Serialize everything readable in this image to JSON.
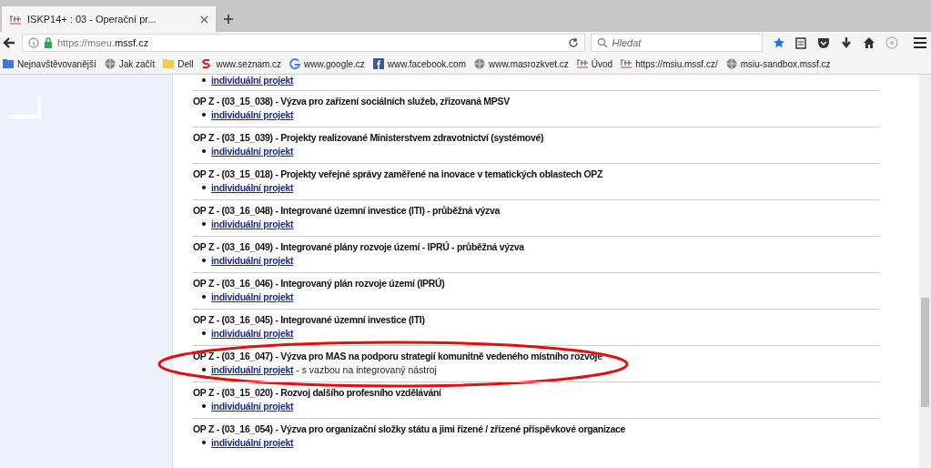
{
  "browser": {
    "tab": {
      "title": "ISKP14+ : 03 - Operační pr...",
      "selected": true
    },
    "url": {
      "prefix": "https://mseu.",
      "domain": "mssf.cz"
    },
    "search": {
      "placeholder": "Hledat"
    },
    "bookmarks": [
      {
        "kind": "folder-blue",
        "label": "Nejnavštěvovanější"
      },
      {
        "kind": "globe",
        "label": "Jak začít"
      },
      {
        "kind": "folder",
        "label": "Dell"
      },
      {
        "kind": "s",
        "label": "www.seznam.cz"
      },
      {
        "kind": "g",
        "label": "www.google.cz"
      },
      {
        "kind": "f",
        "label": "www.facebook.com"
      },
      {
        "kind": "globe",
        "label": "www.masrozkvet.cz"
      },
      {
        "kind": "iskp",
        "label": "Úvod"
      },
      {
        "kind": "iskp",
        "label": "https://msiu.mssf.cz/"
      },
      {
        "kind": "globe",
        "label": "msiu-sandbox.mssf.cz"
      }
    ]
  },
  "calls": [
    {
      "link": "individuální projekt",
      "highlighted": false
    },
    {
      "title": "OP Z - (03_15_038) - Výzva pro zařízení sociálních služeb, zřizovaná MPSV",
      "link": "individuální projekt",
      "highlighted": false
    },
    {
      "title": "OP Z - (03_15_039) - Projekty realizované Ministerstvem zdravotnictví (systémové)",
      "link": "individuální projekt",
      "highlighted": false
    },
    {
      "title": "OP Z - (03_15_018) - Projekty veřejné správy zaměřené na inovace v tematických oblastech OPZ",
      "link": "individuální projekt",
      "highlighted": false
    },
    {
      "title": "OP Z - (03_16_048) - Integrované územní investice (ITI) - průběžná výzva",
      "link": "individuální projekt",
      "highlighted": false
    },
    {
      "title": "OP Z - (03_16_049) - Integrované plány rozvoje území - IPRÚ - průběžná výzva",
      "link": "individuální projekt",
      "highlighted": false
    },
    {
      "title": "OP Z - (03_16_046) - Integrovaný plán rozvoje území (IPRÚ)",
      "link": "individuální projekt",
      "highlighted": false
    },
    {
      "title": "OP Z - (03_16_045) - Integrované územní investice (ITI)",
      "link": "individuální projekt",
      "highlighted": false
    },
    {
      "title": "OP Z - (03_16_047) - Výzva pro MAS na podporu strategií komunitně vedeného místního rozvoje",
      "link": "individuální projekt",
      "note": "- s vazbou na integrovaný nástroj",
      "highlighted": true
    },
    {
      "title": "OP Z - (03_15_020) - Rozvoj dalšího profesního vzdělávání",
      "link": "individuální projekt",
      "highlighted": false
    },
    {
      "title": "OP Z - (03_16_054) - Výzva pro organizační složky státu a jimi řízené / zřízené příspěvkové organizace",
      "link": "individuální projekt",
      "highlighted": false
    }
  ]
}
